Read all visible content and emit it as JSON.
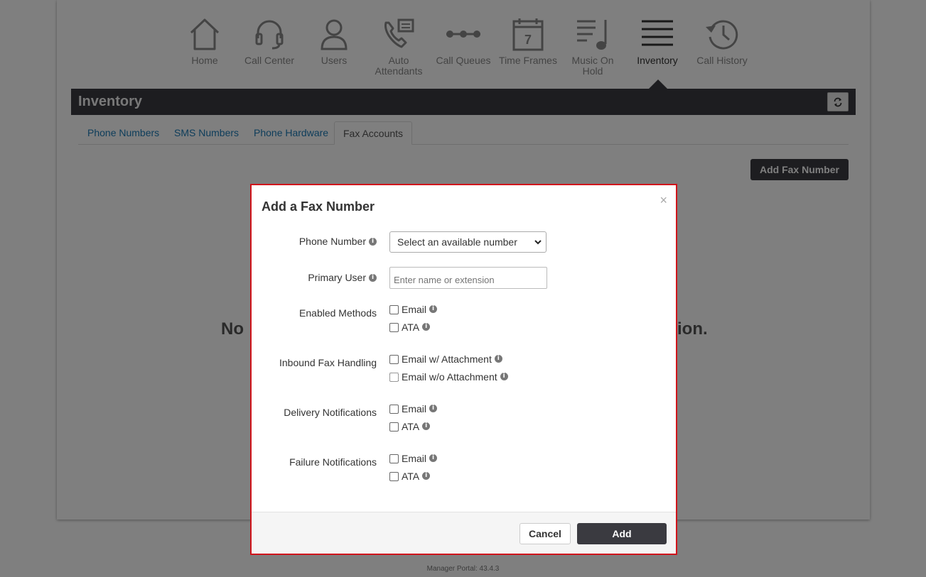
{
  "nav": {
    "items": [
      {
        "label": "Home",
        "icon": "home-icon"
      },
      {
        "label": "Call Center",
        "icon": "headset-icon"
      },
      {
        "label": "Users",
        "icon": "user-icon"
      },
      {
        "label": "Auto Attendants",
        "icon": "phone-menu-icon"
      },
      {
        "label": "Call Queues",
        "icon": "queue-icon"
      },
      {
        "label": "Time Frames",
        "icon": "calendar-icon",
        "day": "7"
      },
      {
        "label": "Music On Hold",
        "icon": "music-icon"
      },
      {
        "label": "Inventory",
        "icon": "list-icon",
        "active": true
      },
      {
        "label": "Call History",
        "icon": "history-icon"
      }
    ]
  },
  "header": {
    "title": "Inventory",
    "refresh_icon": "refresh-icon"
  },
  "tabs": [
    {
      "label": "Phone Numbers"
    },
    {
      "label": "SMS Numbers"
    },
    {
      "label": "Phone Hardware"
    },
    {
      "label": "Fax Accounts",
      "active": true
    }
  ],
  "toolbar": {
    "add_fax_label": "Add Fax Number"
  },
  "main": {
    "empty_left": "No",
    "empty_right": "ion."
  },
  "footer": {
    "version": "Manager Portal: 43.4.3"
  },
  "modal": {
    "title": "Add a Fax Number",
    "close": "×",
    "phone_number": {
      "label": "Phone Number",
      "value": "Select an available number"
    },
    "primary_user": {
      "label": "Primary User",
      "placeholder": "Enter name or extension"
    },
    "enabled_methods": {
      "label": "Enabled Methods",
      "options": [
        "Email",
        "ATA"
      ]
    },
    "inbound_handling": {
      "label": "Inbound Fax Handling",
      "options": [
        "Email w/ Attachment",
        "Email w/o Attachment"
      ]
    },
    "delivery_notifications": {
      "label": "Delivery Notifications",
      "options": [
        "Email",
        "ATA"
      ]
    },
    "failure_notifications": {
      "label": "Failure Notifications",
      "options": [
        "Email",
        "ATA"
      ]
    },
    "cancel_label": "Cancel",
    "add_label": "Add"
  },
  "colors": {
    "accent_dark": "#3a3a40",
    "link": "#1c7bb6",
    "modal_border": "#d0141b"
  }
}
